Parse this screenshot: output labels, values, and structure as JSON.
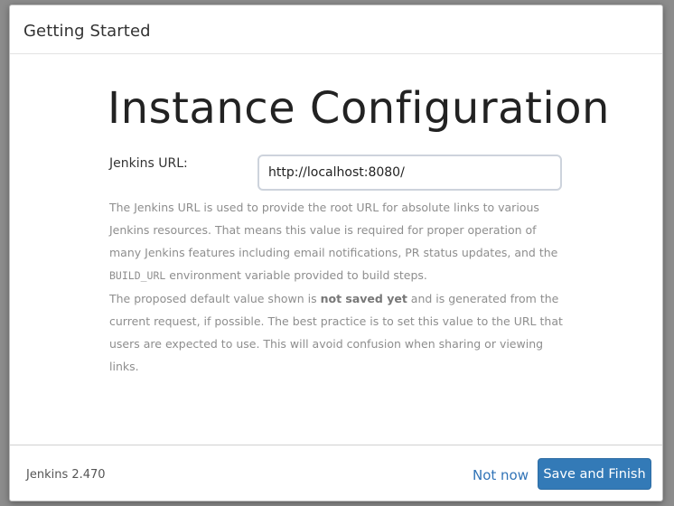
{
  "dialog": {
    "header_title": "Getting Started"
  },
  "main": {
    "title": "Instance Configuration",
    "url_label": "Jenkins URL:",
    "url_value": "http://localhost:8080/",
    "help": {
      "line1_a": "The Jenkins URL is used to provide the root URL for absolute links to various Jenkins resources. That means this value is required for proper operation of many Jenkins features including email notifications, PR status updates, and the ",
      "line1_code": "BUILD_URL",
      "line1_b": " environment variable provided to build steps.",
      "line2_a": "The proposed default value shown is ",
      "line2_bold": "not saved yet",
      "line2_b": " and is generated from the current request, if possible. The best practice is to set this value to the URL that users are expected to use. This will avoid confusion when sharing or viewing links."
    }
  },
  "footer": {
    "version": "Jenkins 2.470",
    "not_now_label": "Not now",
    "save_finish_label": "Save and Finish"
  },
  "colors": {
    "primary_button": "#337ab7",
    "link": "#3174b7",
    "help_text": "#8e8e8e"
  }
}
